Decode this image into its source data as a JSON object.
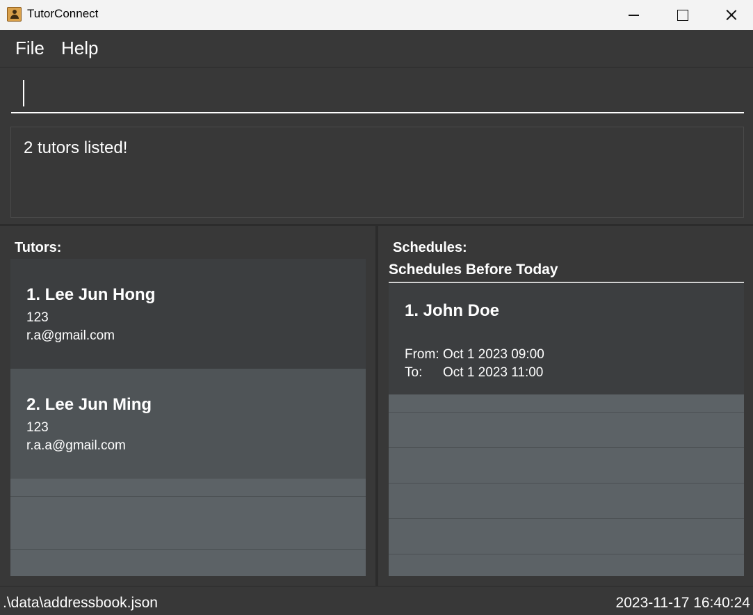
{
  "window": {
    "title": "TutorConnect",
    "icon": "contact-book-icon"
  },
  "menu": {
    "file_label": "File",
    "help_label": "Help"
  },
  "command": {
    "value": ""
  },
  "result": {
    "message": "2 tutors listed!"
  },
  "tutors": {
    "label": "Tutors:",
    "items": [
      {
        "title": "1.  Lee Jun Hong",
        "phone": "123",
        "email": "r.a@gmail.com"
      },
      {
        "title": "2.  Lee Jun Ming",
        "phone": "123",
        "email": "r.a.a@gmail.com"
      }
    ]
  },
  "schedules": {
    "label": "Schedules:",
    "tab_label": "Schedules Before Today",
    "items": [
      {
        "title": "1.  John Doe",
        "from_label": "From:",
        "from_value": "Oct 1 2023 09:00",
        "to_label": "To:",
        "to_value": "Oct 1 2023 11:00"
      }
    ]
  },
  "status": {
    "file_path": ".\\data\\addressbook.json",
    "timestamp": "2023-11-17 16:40:24"
  }
}
